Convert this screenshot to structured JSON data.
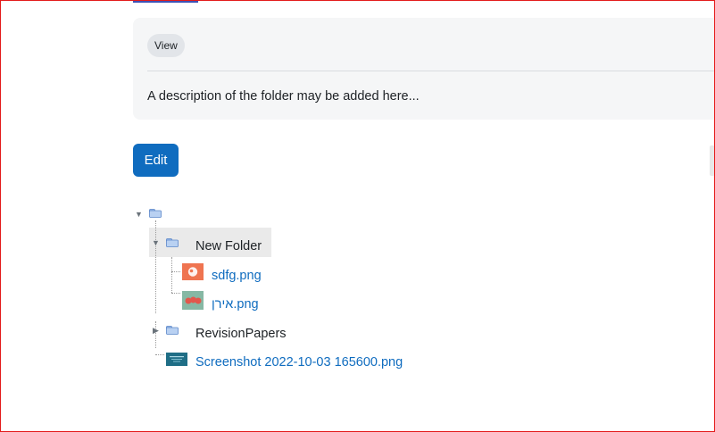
{
  "activity": {
    "view_label": "View",
    "description": "A description of the folder may be added here..."
  },
  "actions": {
    "edit_label": "Edit"
  },
  "tree": {
    "new_folder": {
      "label": "New Folder",
      "files": [
        "sdfg.png",
        "אירן.png"
      ]
    },
    "revision_folder": {
      "label": "RevisionPapers"
    },
    "root_file": "Screenshot 2022-10-03 165600.png"
  },
  "colors": {
    "accent": "#0f6cbf",
    "frame": "#e31b1b"
  }
}
